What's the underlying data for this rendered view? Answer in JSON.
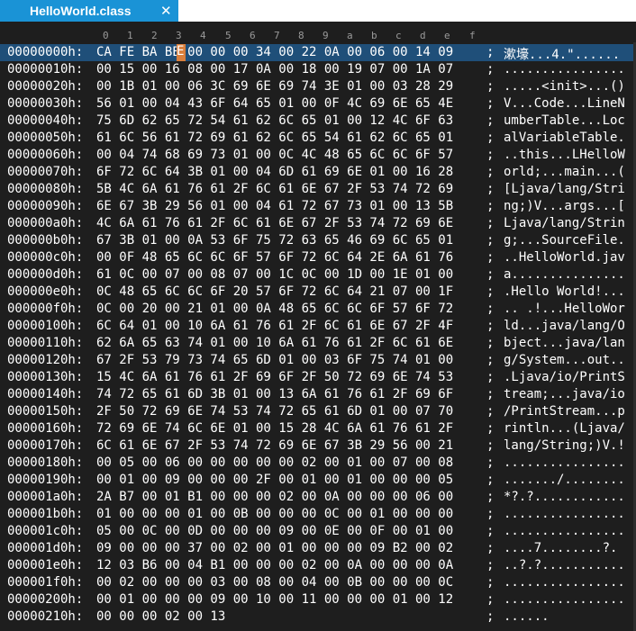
{
  "tab": {
    "title": "HelloWorld.class",
    "close_label": "✕"
  },
  "columns": [
    "0",
    "1",
    "2",
    "3",
    "4",
    "5",
    "6",
    "7",
    "8",
    "9",
    "a",
    "b",
    "c",
    "d",
    "e",
    "f"
  ],
  "cursor_char": "E",
  "rows": [
    {
      "addr": "00000000h:",
      "hex": "CA FE BA BE 00 00 00 34 00 22 0A 00 06 00 14 09",
      "sep": ";",
      "ascii": "漱壕...4.\"......"
    },
    {
      "addr": "00000010h:",
      "hex": "00 15 00 16 08 00 17 0A 00 18 00 19 07 00 1A 07",
      "sep": ";",
      "ascii": "................"
    },
    {
      "addr": "00000020h:",
      "hex": "00 1B 01 00 06 3C 69 6E 69 74 3E 01 00 03 28 29",
      "sep": ";",
      "ascii": ".....<init>...()"
    },
    {
      "addr": "00000030h:",
      "hex": "56 01 00 04 43 6F 64 65 01 00 0F 4C 69 6E 65 4E",
      "sep": ";",
      "ascii": "V...Code...LineN"
    },
    {
      "addr": "00000040h:",
      "hex": "75 6D 62 65 72 54 61 62 6C 65 01 00 12 4C 6F 63",
      "sep": ";",
      "ascii": "umberTable...Loc"
    },
    {
      "addr": "00000050h:",
      "hex": "61 6C 56 61 72 69 61 62 6C 65 54 61 62 6C 65 01",
      "sep": ";",
      "ascii": "alVariableTable."
    },
    {
      "addr": "00000060h:",
      "hex": "00 04 74 68 69 73 01 00 0C 4C 48 65 6C 6C 6F 57",
      "sep": ";",
      "ascii": "..this...LHelloW"
    },
    {
      "addr": "00000070h:",
      "hex": "6F 72 6C 64 3B 01 00 04 6D 61 69 6E 01 00 16 28",
      "sep": ";",
      "ascii": "orld;...main...("
    },
    {
      "addr": "00000080h:",
      "hex": "5B 4C 6A 61 76 61 2F 6C 61 6E 67 2F 53 74 72 69",
      "sep": ";",
      "ascii": "[Ljava/lang/Stri"
    },
    {
      "addr": "00000090h:",
      "hex": "6E 67 3B 29 56 01 00 04 61 72 67 73 01 00 13 5B",
      "sep": ";",
      "ascii": "ng;)V...args...["
    },
    {
      "addr": "000000a0h:",
      "hex": "4C 6A 61 76 61 2F 6C 61 6E 67 2F 53 74 72 69 6E",
      "sep": ";",
      "ascii": "Ljava/lang/Strin"
    },
    {
      "addr": "000000b0h:",
      "hex": "67 3B 01 00 0A 53 6F 75 72 63 65 46 69 6C 65 01",
      "sep": ";",
      "ascii": "g;...SourceFile."
    },
    {
      "addr": "000000c0h:",
      "hex": "00 0F 48 65 6C 6C 6F 57 6F 72 6C 64 2E 6A 61 76",
      "sep": ";",
      "ascii": "..HelloWorld.jav"
    },
    {
      "addr": "000000d0h:",
      "hex": "61 0C 00 07 00 08 07 00 1C 0C 00 1D 00 1E 01 00",
      "sep": ";",
      "ascii": "a..............."
    },
    {
      "addr": "000000e0h:",
      "hex": "0C 48 65 6C 6C 6F 20 57 6F 72 6C 64 21 07 00 1F",
      "sep": ";",
      "ascii": ".Hello World!..."
    },
    {
      "addr": "000000f0h:",
      "hex": "0C 00 20 00 21 01 00 0A 48 65 6C 6C 6F 57 6F 72",
      "sep": ";",
      "ascii": ".. .!...HelloWor"
    },
    {
      "addr": "00000100h:",
      "hex": "6C 64 01 00 10 6A 61 76 61 2F 6C 61 6E 67 2F 4F",
      "sep": ";",
      "ascii": "ld...java/lang/O"
    },
    {
      "addr": "00000110h:",
      "hex": "62 6A 65 63 74 01 00 10 6A 61 76 61 2F 6C 61 6E",
      "sep": ";",
      "ascii": "bject...java/lan"
    },
    {
      "addr": "00000120h:",
      "hex": "67 2F 53 79 73 74 65 6D 01 00 03 6F 75 74 01 00",
      "sep": ";",
      "ascii": "g/System...out.."
    },
    {
      "addr": "00000130h:",
      "hex": "15 4C 6A 61 76 61 2F 69 6F 2F 50 72 69 6E 74 53",
      "sep": ";",
      "ascii": ".Ljava/io/PrintS"
    },
    {
      "addr": "00000140h:",
      "hex": "74 72 65 61 6D 3B 01 00 13 6A 61 76 61 2F 69 6F",
      "sep": ";",
      "ascii": "tream;...java/io"
    },
    {
      "addr": "00000150h:",
      "hex": "2F 50 72 69 6E 74 53 74 72 65 61 6D 01 00 07 70",
      "sep": ";",
      "ascii": "/PrintStream...p"
    },
    {
      "addr": "00000160h:",
      "hex": "72 69 6E 74 6C 6E 01 00 15 28 4C 6A 61 76 61 2F",
      "sep": ";",
      "ascii": "rintln...(Ljava/"
    },
    {
      "addr": "00000170h:",
      "hex": "6C 61 6E 67 2F 53 74 72 69 6E 67 3B 29 56 00 21",
      "sep": ";",
      "ascii": "lang/String;)V.!"
    },
    {
      "addr": "00000180h:",
      "hex": "00 05 00 06 00 00 00 00 00 02 00 01 00 07 00 08",
      "sep": ";",
      "ascii": "................"
    },
    {
      "addr": "00000190h:",
      "hex": "00 01 00 09 00 00 00 2F 00 01 00 01 00 00 00 05",
      "sep": ";",
      "ascii": "......./........"
    },
    {
      "addr": "000001a0h:",
      "hex": "2A B7 00 01 B1 00 00 00 02 00 0A 00 00 00 06 00",
      "sep": ";",
      "ascii": "*?.?............"
    },
    {
      "addr": "000001b0h:",
      "hex": "01 00 00 00 01 00 0B 00 00 00 0C 00 01 00 00 00",
      "sep": ";",
      "ascii": "................"
    },
    {
      "addr": "000001c0h:",
      "hex": "05 00 0C 00 0D 00 00 00 09 00 0E 00 0F 00 01 00",
      "sep": ";",
      "ascii": "................"
    },
    {
      "addr": "000001d0h:",
      "hex": "09 00 00 00 37 00 02 00 01 00 00 00 09 B2 00 02",
      "sep": ";",
      "ascii": "....7........?."
    },
    {
      "addr": "000001e0h:",
      "hex": "12 03 B6 00 04 B1 00 00 00 02 00 0A 00 00 00 0A",
      "sep": ";",
      "ascii": "..?.?..........."
    },
    {
      "addr": "000001f0h:",
      "hex": "00 02 00 00 00 03 00 08 00 04 00 0B 00 00 00 0C",
      "sep": ";",
      "ascii": "................"
    },
    {
      "addr": "00000200h:",
      "hex": "00 01 00 00 00 09 00 10 00 11 00 00 00 01 00 12",
      "sep": ";",
      "ascii": "................"
    },
    {
      "addr": "00000210h:",
      "hex": "00 00 00 02 00 13",
      "sep": ";",
      "ascii": "......"
    }
  ]
}
